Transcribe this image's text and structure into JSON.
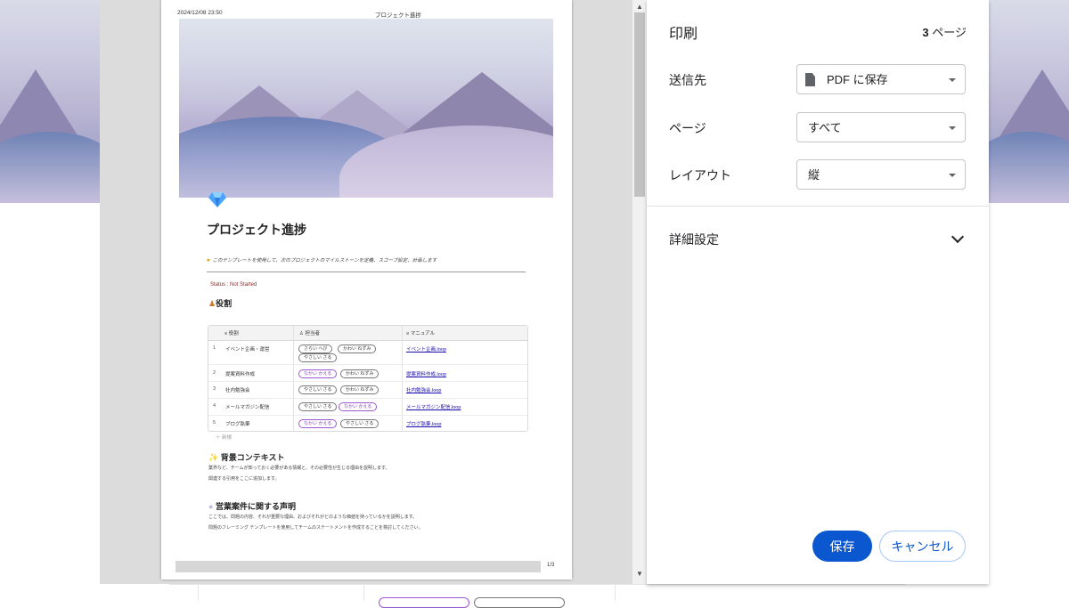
{
  "document": {
    "timestamp": "2024/12/08 23:50",
    "header_title": "プロジェクト進捗",
    "title": "プロジェクト進捗",
    "hint": "このテンプレートを使用して、次のプロジェクトのマイルストーンを定義、スコープ設定、計画します",
    "status": "Status : Not Started",
    "roles_heading": "役割",
    "table": {
      "columns": [
        "役割",
        "担当者",
        "マニュアル"
      ],
      "rows": [
        {
          "num": "1",
          "role": "イベント企画・運営",
          "assignees": [
            "さらい へび",
            "かわい ねずみ",
            "やさしい さる"
          ],
          "manual": "イベント企画.loop"
        },
        {
          "num": "2",
          "role": "提案資料作成",
          "assignees": [
            "なかい かえる",
            "かわい ねずみ"
          ],
          "manual": "提案資料作成.loop"
        },
        {
          "num": "3",
          "role": "社内勉強会",
          "assignees": [
            "やさしい さる",
            "かわい ねずみ"
          ],
          "manual": "社内勉強会.loop"
        },
        {
          "num": "4",
          "role": "メールマガジン配信",
          "assignees": [
            "やさしい さる",
            "なかい かえる"
          ],
          "manual": "メールマガジン配信.loop"
        },
        {
          "num": "5",
          "role": "ブログ執筆",
          "assignees": [
            "なかい かえる",
            "やさしい さる"
          ],
          "manual": "ブログ執筆.loop"
        }
      ],
      "new_row": "新規"
    },
    "bg_heading": "背景コンテキスト",
    "bg_p1": "業界など、チームが知っておく必要がある情報と、その必要性が生じる理由を説明します。",
    "bg_p2": "関連する引用をここに追加します。",
    "stmt_heading": "営業案件に関する声明",
    "stmt_p1": "ここでは、問題の内容、それが重要な理由、およびそれがどのような価値を持っているかを説明します。",
    "stmt_p2": "問題のフレーミング テンプレートを使用してチームのステートメントを作成することを検討してください。",
    "page_number": "1/3"
  },
  "print_panel": {
    "title": "印刷",
    "page_count": "3",
    "page_count_suffix": "ページ",
    "destination_label": "送信先",
    "destination_value": "PDF に保存",
    "pages_label": "ページ",
    "pages_value": "すべて",
    "layout_label": "レイアウト",
    "layout_value": "縦",
    "advanced_label": "詳細設定",
    "save_button": "保存",
    "cancel_button": "キャンセル"
  },
  "colors": {
    "accent": "#0b57d0",
    "chip_purple": "#9b59d0",
    "status_red": "#8a2b2b"
  }
}
